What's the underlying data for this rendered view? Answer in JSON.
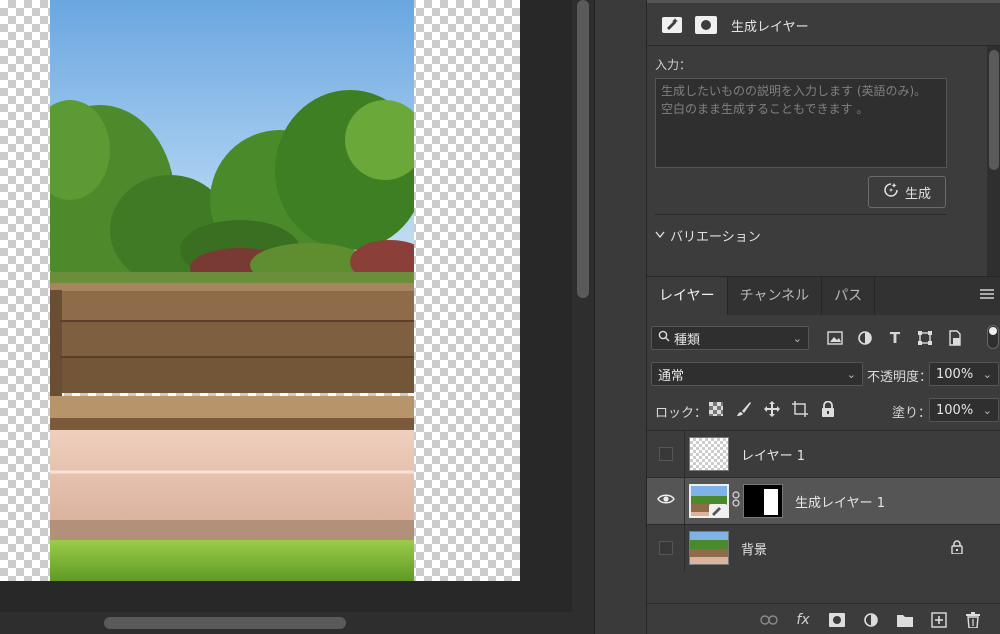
{
  "properties": {
    "title": "生成レイヤー",
    "input_label": "入力：",
    "prompt_placeholder_line1": "生成したいものの説明を入力します (英語のみ)。",
    "prompt_placeholder_line2": "空白のまま生成することもできます 。",
    "generate_label": "生成",
    "variations_label": "バリエーション"
  },
  "layers_panel": {
    "tabs": [
      {
        "label": "レイヤー",
        "active": true
      },
      {
        "label": "チャンネル",
        "active": false
      },
      {
        "label": "パス",
        "active": false
      }
    ],
    "filter_kind": "種類",
    "blend_mode": "通常",
    "opacity_label": "不透明度：",
    "opacity_value": "100%",
    "lock_label": "ロック：",
    "fill_label": "塗り：",
    "fill_value": "100%",
    "layers": [
      {
        "name": "レイヤー 1",
        "visible": false,
        "selected": false,
        "locked": false
      },
      {
        "name": "生成レイヤー 1",
        "visible": true,
        "selected": true,
        "locked": false
      },
      {
        "name": "背景",
        "visible": false,
        "selected": false,
        "locked": true
      }
    ],
    "bottom_icons": [
      "link-icon",
      "fx-icon",
      "mask-icon",
      "adjustment-icon",
      "folder-icon",
      "new-layer-icon",
      "trash-icon"
    ]
  }
}
